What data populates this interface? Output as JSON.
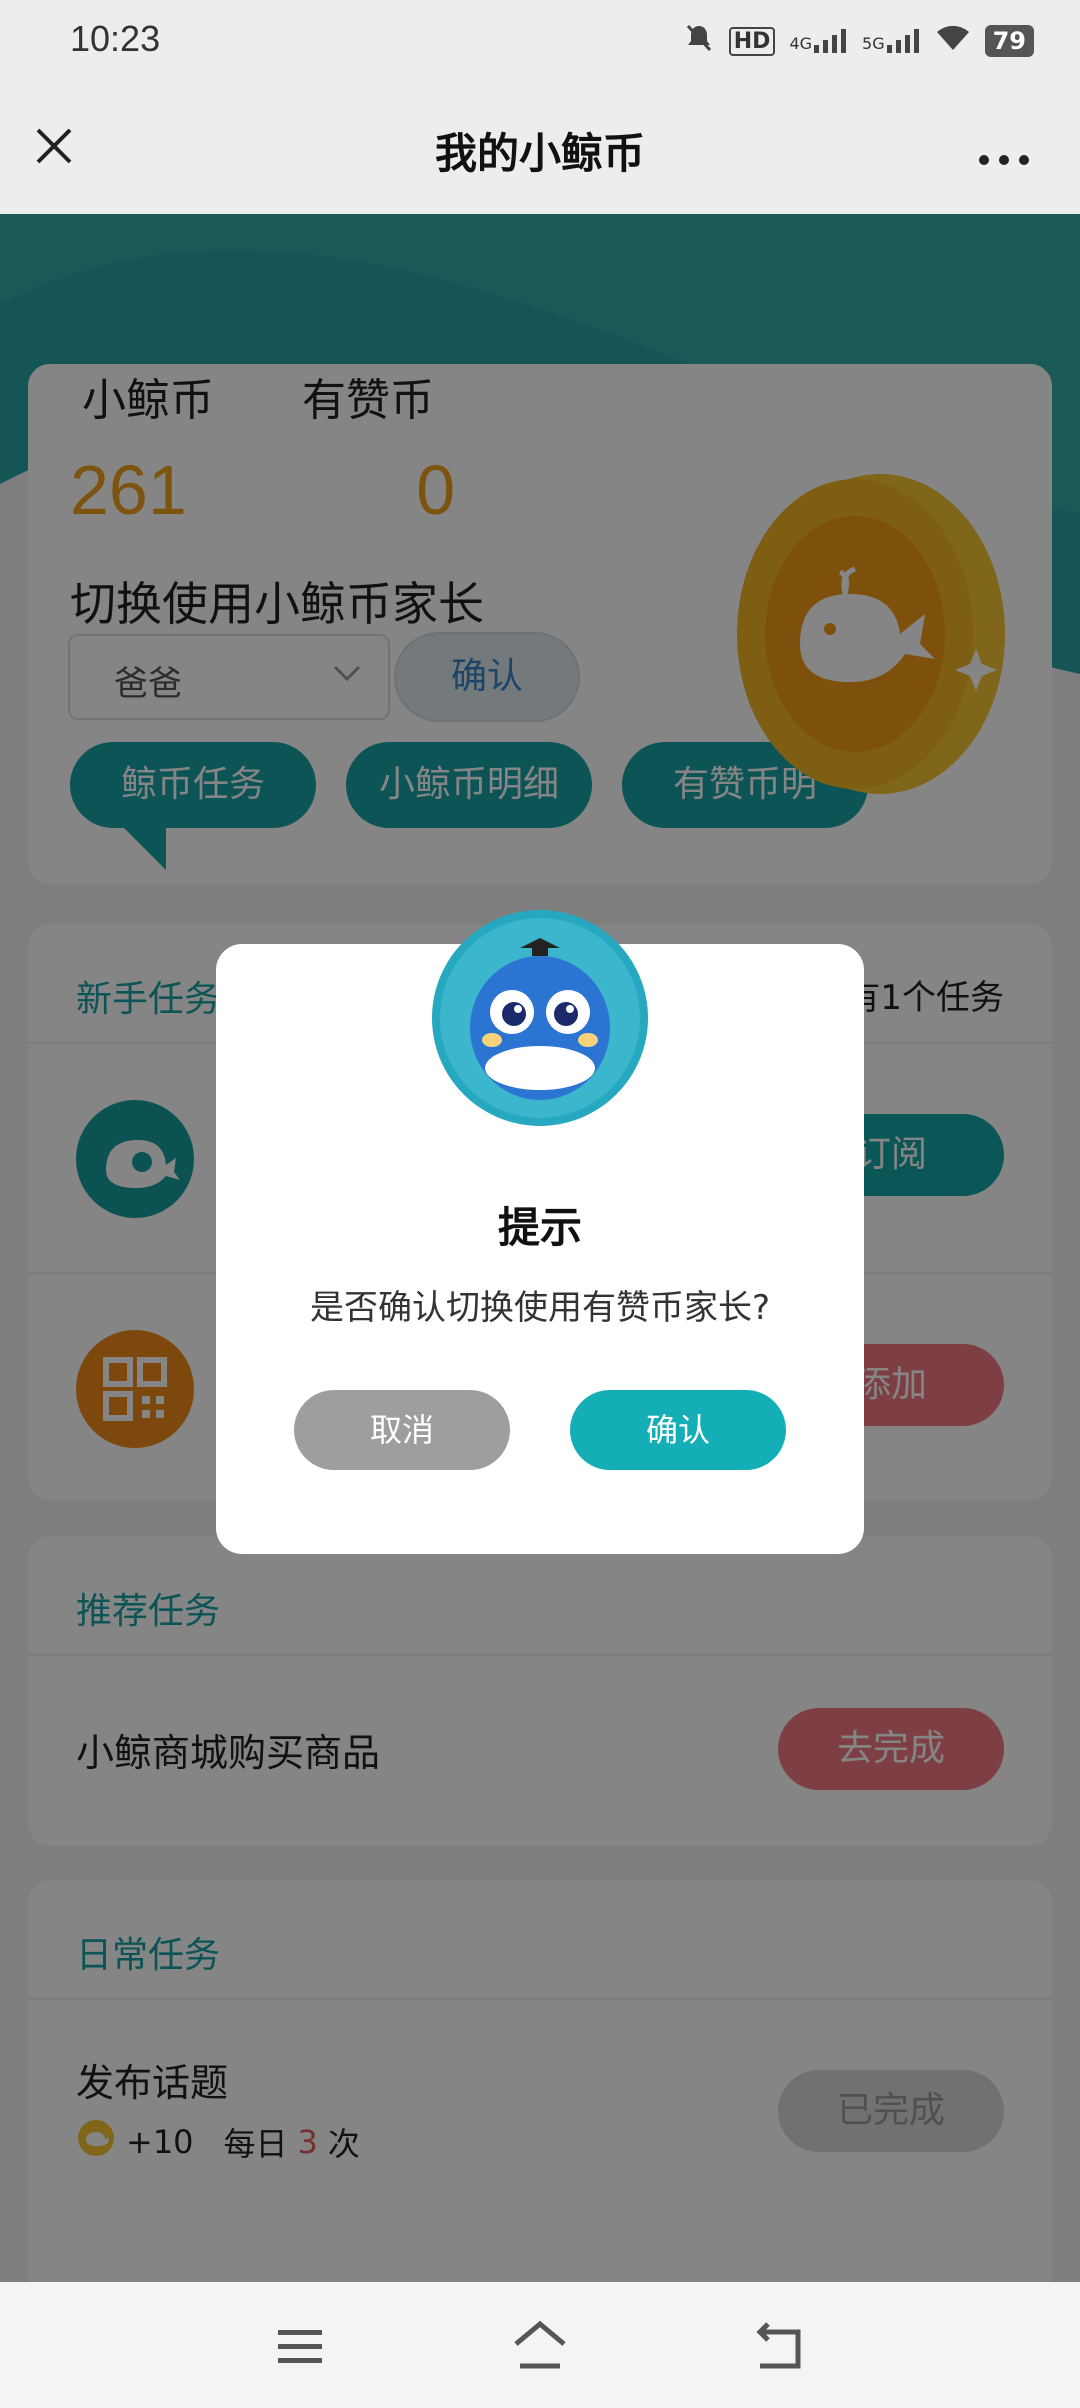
{
  "status_bar": {
    "time": "10:23",
    "network_1": "4G",
    "network_2": "5G",
    "hd": "HD",
    "battery": "79",
    "icons": [
      "mute-icon",
      "hd-icon",
      "signal-4g-icon",
      "signal-5g-icon",
      "wifi-icon",
      "battery-icon"
    ]
  },
  "title_bar": {
    "title": "我的小鲸币",
    "close_icon": "close-icon",
    "more_icon": "more-icon"
  },
  "hero": {
    "coin_label_1": "小鲸币",
    "coin_label_2": "有赞币",
    "coin_value_1": "261",
    "coin_value_2": "0",
    "switch_title": "切换使用小鲸币家长",
    "selected_parent": "爸爸",
    "confirm_label": "确认",
    "tabs": [
      "鲸币任务",
      "小鲸币明细",
      "有赞币明"
    ]
  },
  "newbie_tasks": {
    "header": "新手任务",
    "right_note": "有1个任务",
    "rows": [
      {
        "button": "订阅"
      },
      {
        "button": "添加"
      }
    ]
  },
  "recommended_tasks": {
    "header": "推荐任务",
    "rows": [
      {
        "title": "小鲸商城购买商品",
        "button": "去完成"
      }
    ]
  },
  "daily_tasks": {
    "header": "日常任务",
    "rows": [
      {
        "title": "发布话题",
        "reward": "+10",
        "freq_prefix": "每日",
        "freq_count": "3",
        "freq_suffix": "次",
        "button": "已完成"
      }
    ]
  },
  "dialog": {
    "title": "提示",
    "message": "是否确认切换使用有赞币家长?",
    "cancel": "取消",
    "confirm": "确认"
  },
  "nav_bar": {
    "icons": [
      "menu-icon",
      "home-icon",
      "back-icon"
    ]
  },
  "colors": {
    "accent_teal": "#17a2a3",
    "coin_orange": "#f0a020",
    "danger_red": "#f07a80"
  }
}
